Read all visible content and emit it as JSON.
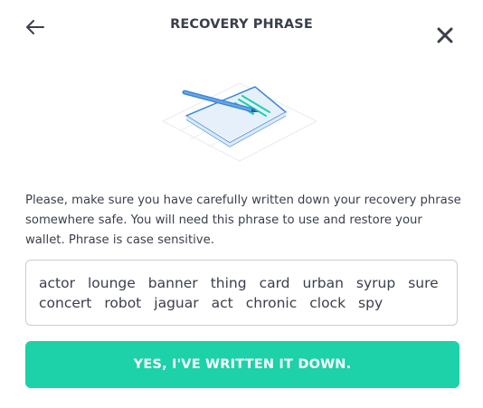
{
  "header": {
    "title": "RECOVERY PHRASE",
    "back_icon": "arrow-left-icon",
    "close_icon": "close-icon"
  },
  "illustration": {
    "icon": "notepad-pen-illustration",
    "accent_color": "#1dd1a8",
    "pen_color": "#3d86d6"
  },
  "description": "Please, make sure you have carefully written down your recovery phrase somewhere safe. You will need this phrase to use and restore your wallet. Phrase is case sensitive.",
  "phrase": {
    "words": [
      "actor",
      "lounge",
      "banner",
      "thing",
      "card",
      "urban",
      "syrup",
      "sure",
      "concert",
      "robot",
      "jaguar",
      "act",
      "chronic",
      "clock",
      "spy"
    ]
  },
  "confirm_button": {
    "label": "YES, I'VE WRITTEN IT DOWN.",
    "color": "#1dd1a8"
  }
}
